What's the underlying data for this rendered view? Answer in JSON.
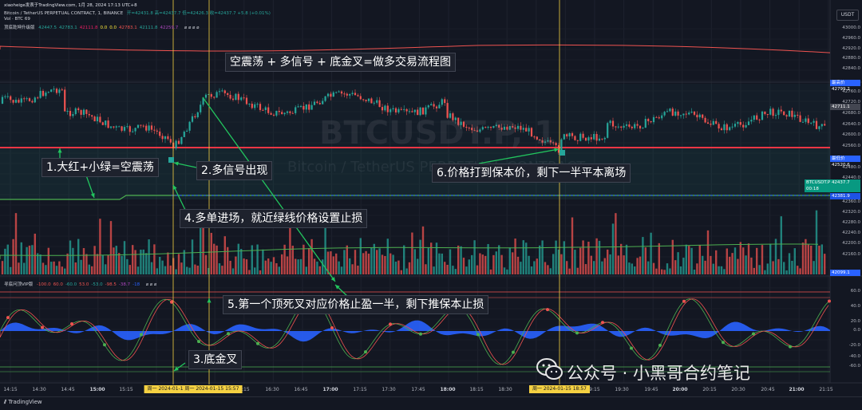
{
  "header": {
    "line1": "xiaoheige发表于TradingView.com,  1月 28, 2024 17:13 UTC+8",
    "line2_symbol": "Bitcoin / TetherUS PERPETUAL CONTRACT, 1, BINANCE",
    "line2_ohlc": "开=42431.8  高=42437.7  低=42426.3  收=42437.7  +5.8 (+0.01%)",
    "line3": "Vol · BTC  69",
    "line4_name": "顶底乾坤升级版",
    "line4_values": [
      "42447.5",
      "42783.1",
      "42111.8",
      "0.0",
      "0.0",
      "42783.1",
      "42111.8",
      "42259.7"
    ]
  },
  "currency_button": "USDT",
  "price_axis": [
    "43000.0",
    "42960.0",
    "42920.0",
    "42880.0",
    "42840.0",
    "42760.0",
    "42720.0",
    "42680.0",
    "42640.0",
    "42600.0",
    "42560.0",
    "42480.0",
    "42440.0",
    "42400.0",
    "42360.0",
    "42320.0",
    "42280.0",
    "42240.0",
    "42200.0",
    "42160.0",
    "42120.0"
  ],
  "price_tags": {
    "high_label": "最高价",
    "high_value": "42799.2",
    "last_label": "42711.1",
    "low_label": "最低价",
    "low_value": "42520.6",
    "symbol_label": "BTCUSDT.P",
    "symbol_value": "42437.7",
    "countdown": "00:18",
    "green_line": "42381.9",
    "vol_value": "42099.1"
  },
  "osc_header": {
    "name": "寻底问顶VIP版",
    "values": [
      "-100.0",
      "60.0",
      "-60.0",
      "53.0",
      "-53.0",
      "-98.5",
      "-38.7",
      "-18"
    ]
  },
  "osc_axis": [
    "60.0",
    "40.0",
    "20.0",
    "0.0",
    "-20.0",
    "-40.0",
    "-60.0"
  ],
  "watermark_symbol": "BTCUSDT.P, 1",
  "watermark_sub": "Bitcoin / TetherUS PERPETUAL CONTRACT",
  "annotations": {
    "title": "空震荡 + 多信号 + 底金叉=做多交易流程图",
    "a1": "1.大红+小绿=空震荡",
    "a2": "2.多信号出现",
    "a3": "3.底金叉",
    "a4": "4.多单进场，就近绿线价格设置止损",
    "a5": "5.第一个顶死叉对应价格止盈一半，剩下推保本止损",
    "a6": "6.价格打到保本价，剩下一半平本离场"
  },
  "time_axis": [
    "14:15",
    "14:30",
    "14:45",
    "15:00",
    "15:15",
    "15:45",
    "16:15",
    "16:30",
    "16:45",
    "17:00",
    "17:15",
    "17:30",
    "17:45",
    "18:00",
    "18:15",
    "18:30",
    "19:15",
    "19:30",
    "19:45",
    "20:00",
    "20:15",
    "20:30",
    "20:45",
    "21:00",
    "21:15"
  ],
  "time_highlights": [
    "周一 2024-01-1   周一 2024-01-15  15:57",
    "周一 2024-01-15  18:57"
  ],
  "watermark_text": "公众号 · 小黑哥合约笔记",
  "footer": "TradingView",
  "colors": {
    "bg": "#131722",
    "up": "#26a69a",
    "down": "#ef5350",
    "red_line": "#f23645",
    "green_line": "#4caf50",
    "histogram": "#2962ff",
    "vline": "#f5d142"
  }
}
